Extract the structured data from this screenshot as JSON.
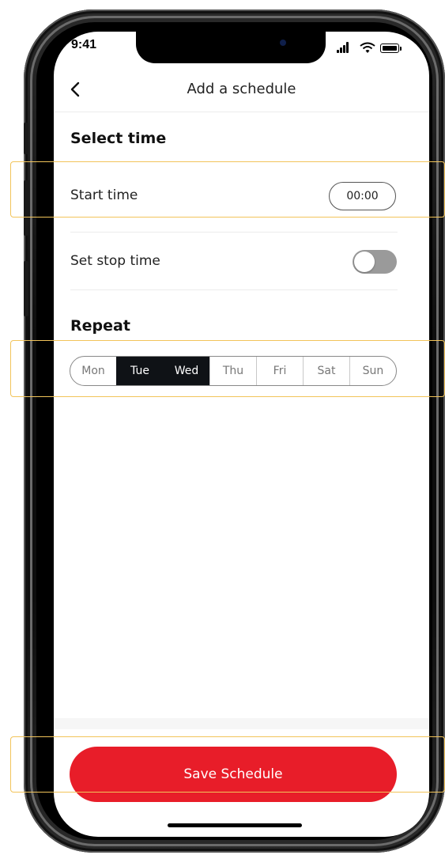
{
  "status_bar": {
    "time": "9:41"
  },
  "header": {
    "title": "Add a schedule"
  },
  "select_time": {
    "title": "Select time",
    "start_time_label": "Start time",
    "start_time_value": "00:00",
    "stop_time_label": "Set stop time",
    "stop_time_enabled": false
  },
  "repeat": {
    "title": "Repeat",
    "days": [
      {
        "label": "Mon",
        "selected": false
      },
      {
        "label": "Tue",
        "selected": true
      },
      {
        "label": "Wed",
        "selected": true
      },
      {
        "label": "Thu",
        "selected": false
      },
      {
        "label": "Fri",
        "selected": false
      },
      {
        "label": "Sat",
        "selected": false
      },
      {
        "label": "Sun",
        "selected": false
      }
    ]
  },
  "footer": {
    "save_label": "Save Schedule"
  },
  "colors": {
    "accent": "#e81d29",
    "selected_day": "#0f1216",
    "highlight": "#f2c45a",
    "toggle_off": "#9a9a9a"
  }
}
